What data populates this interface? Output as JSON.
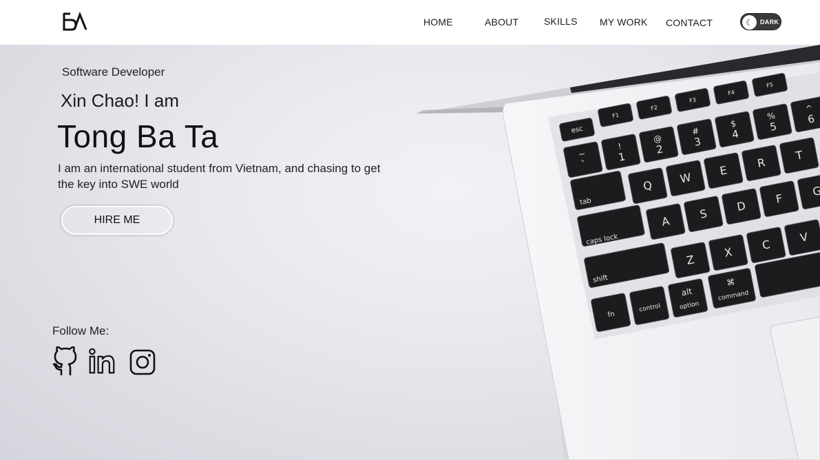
{
  "nav": {
    "logo_text": "BA",
    "items": [
      {
        "label": "HOME"
      },
      {
        "label": "ABOUT"
      },
      {
        "label": "SKILLS"
      },
      {
        "label": "MY WORK"
      },
      {
        "label": "CONTACT"
      }
    ],
    "theme_toggle": {
      "label": "DARK",
      "icon": "moon-icon"
    }
  },
  "hero": {
    "subtitle": "Software Developer",
    "greeting": "Xin Chao! I am",
    "name": "Tong Ba Ta",
    "description": "I am an international student from Vietnam, and chasing to get the key into SWE world",
    "cta_label": "HIRE ME",
    "background_image": "laptop-keyboard-photo"
  },
  "social": {
    "heading": "Follow Me:",
    "icons": [
      "github-icon",
      "linkedin-icon",
      "instagram-icon"
    ]
  },
  "keyboard": {
    "fn_row": [
      "esc",
      "F1",
      "F2",
      "F3",
      "F4",
      "F5"
    ],
    "num_row": [
      "~",
      "!",
      "@",
      "#",
      "$",
      "%",
      "^"
    ],
    "num_row_bottom": [
      "`",
      "1",
      "2",
      "3",
      "4",
      "5",
      "6"
    ],
    "qwerty": [
      "Q",
      "W",
      "E",
      "R",
      "T"
    ],
    "asdf": [
      "A",
      "S",
      "D",
      "F",
      "G"
    ],
    "zxcv": [
      "Z",
      "X",
      "C",
      "V"
    ],
    "mods": {
      "tab": "tab",
      "caps": "caps lock",
      "shift": "shift",
      "fn": "fn",
      "control": "control",
      "alt": "alt",
      "option": "option",
      "command": "command",
      "cmd_symbol": "⌘"
    }
  },
  "colors": {
    "nav_bg": "#ffffff",
    "hero_bg": "#e6e6ec",
    "key": "#1e1e1e",
    "laptop": "#f4f4f6"
  }
}
